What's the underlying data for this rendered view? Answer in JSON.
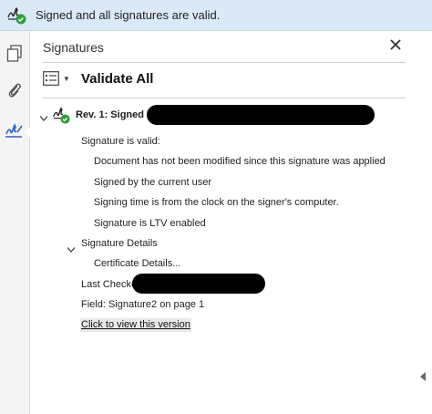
{
  "status_bar": {
    "message": "Signed and all signatures are valid.",
    "icon": "signature-valid-icon"
  },
  "left_rail": {
    "tools": [
      {
        "name": "pages",
        "icon": "pages-icon"
      },
      {
        "name": "attachments",
        "icon": "paperclip-icon"
      },
      {
        "name": "signatures",
        "icon": "signature-pen-icon",
        "active": true
      }
    ]
  },
  "panel": {
    "title": "Signatures",
    "options_icon": "options-menu-icon",
    "validate_all_label": "Validate All"
  },
  "signature": {
    "rev_label": "Rev. 1: Signed b",
    "valid_heading": "Signature is valid:",
    "details": [
      "Document has not been modified since this signature was applied",
      "Signed by the current user",
      "Signing time is from the clock on the signer's computer.",
      "Signature is LTV enabled"
    ],
    "signature_details_label": "Signature Details",
    "certificate_details_label": "Certificate Details...",
    "last_checked_label": "Last Checke",
    "field_label": "Field: Signature2 on page 1",
    "view_version_link": "Click to view this version"
  },
  "colors": {
    "status_bar_bg": "#dbe9f7",
    "valid_green": "#2e9d3a",
    "accent_blue": "#2b67c7"
  }
}
